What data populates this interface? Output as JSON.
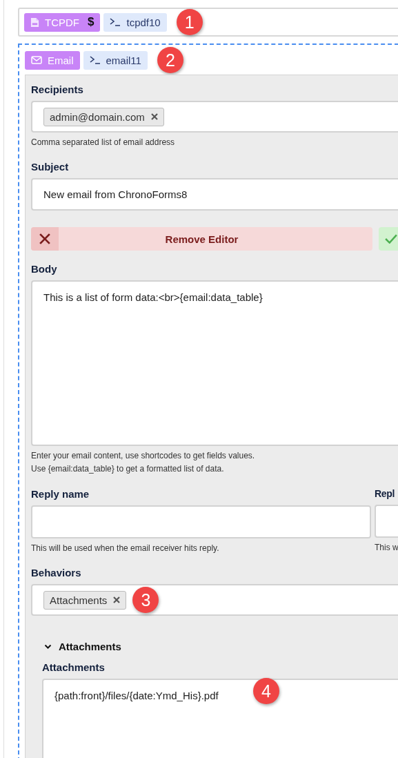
{
  "header_block": {
    "type_label": "TCPDF",
    "suffix": "$",
    "name": "tcpdf10",
    "callout": "1"
  },
  "email_block": {
    "type_label": "Email",
    "name": "email11",
    "callout": "2",
    "recipients": {
      "label": "Recipients",
      "tags": [
        "admin@domain.com"
      ],
      "help": "Comma separated list of email address"
    },
    "subject": {
      "label": "Subject",
      "value": "New email from ChronoForms8"
    },
    "editor_buttons": [
      {
        "kind": "remove",
        "label": "Remove Editor"
      },
      {
        "kind": "enable"
      }
    ],
    "body": {
      "label": "Body",
      "value": "This is a list of form data:<br>{email:data_table}",
      "help": [
        "Enter your email content, use shortcodes to get fields values.",
        "Use {email:data_table} to get a formatted list of data."
      ]
    },
    "reply_name": {
      "label": "Reply name",
      "help": "This will be used when the email receiver hits reply."
    },
    "reply_column_2": {
      "label": "Repl",
      "help": "This w"
    },
    "behaviors": {
      "label": "Behaviors",
      "tags": [
        "Attachments"
      ],
      "callout": "3"
    },
    "attachments_section": {
      "title": "Attachments",
      "expanded": true,
      "label": "Attachments",
      "value": "{path:front}/files/{date:Ymd_His}.pdf",
      "callout": "4"
    }
  }
}
